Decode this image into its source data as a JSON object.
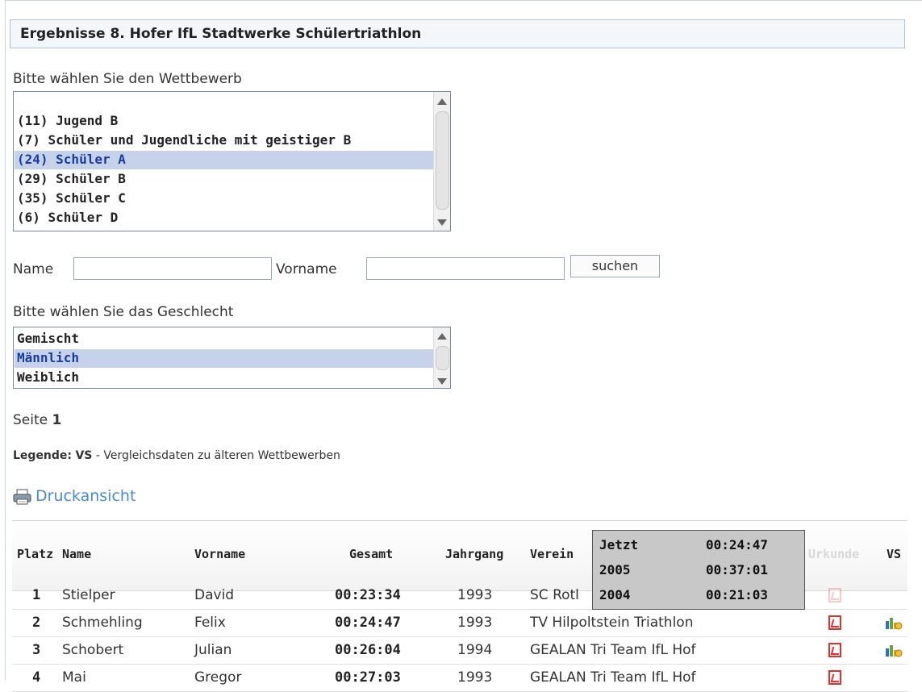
{
  "page": {
    "title": "Ergebnisse 8. Hofer IfL Stadtwerke Schülertriathlon"
  },
  "competition": {
    "label": "Bitte wählen Sie den Wettbewerb",
    "options": [
      {
        "text": "(11) Jugend B",
        "selected": false
      },
      {
        "text": "(7) Schüler und Jugendliche mit geistiger B",
        "selected": false
      },
      {
        "text": "(24) Schüler A",
        "selected": true
      },
      {
        "text": "(29) Schüler B",
        "selected": false
      },
      {
        "text": "(35) Schüler C",
        "selected": false
      },
      {
        "text": "(6) Schüler D",
        "selected": false
      }
    ]
  },
  "search": {
    "name_label": "Name",
    "name_value": "",
    "vorname_label": "Vorname",
    "vorname_value": "",
    "button_label": "suchen"
  },
  "gender": {
    "label": "Bitte wählen Sie das Geschlecht",
    "options": [
      {
        "text": "Gemischt",
        "selected": false
      },
      {
        "text": "Männlich",
        "selected": true
      },
      {
        "text": "Weiblich",
        "selected": false
      }
    ]
  },
  "paging": {
    "label": "Seite",
    "page": "1"
  },
  "legend": {
    "title": "Legende:",
    "key": "VS",
    "text": "- Vergleichsdaten zu älteren Wettbewerben"
  },
  "print": {
    "icon": "printer-icon",
    "label": "Druckansicht"
  },
  "table": {
    "headers": {
      "platz": "Platz",
      "name": "Name",
      "vorname": "Vorname",
      "gesamt": "Gesamt",
      "jahrgang": "Jahrgang",
      "verein": "Verein",
      "urkunde": "Urkunde",
      "vs": "VS"
    },
    "rows": [
      {
        "platz": "1",
        "name": "Stielper",
        "vorname": "David",
        "gesamt": "00:23:34",
        "jahrgang": "1993",
        "verein": "SC Rotl",
        "urkunde": true,
        "vs": false
      },
      {
        "platz": "2",
        "name": "Schmehling",
        "vorname": "Felix",
        "gesamt": "00:24:47",
        "jahrgang": "1993",
        "verein": "TV Hilpoltstein Triathlon",
        "urkunde": true,
        "vs": true
      },
      {
        "platz": "3",
        "name": "Schobert",
        "vorname": "Julian",
        "gesamt": "00:26:04",
        "jahrgang": "1994",
        "verein": "GEALAN Tri Team IfL Hof",
        "urkunde": true,
        "vs": true
      },
      {
        "platz": "4",
        "name": "Mai",
        "vorname": "Gregor",
        "gesamt": "00:27:03",
        "jahrgang": "1993",
        "verein": "GEALAN Tri Team IfL Hof",
        "urkunde": true,
        "vs": false
      }
    ]
  },
  "tooltip": {
    "rows": [
      {
        "label": "Jetzt",
        "time": "00:24:47"
      },
      {
        "label": "2005",
        "time": "00:37:01"
      },
      {
        "label": "2004",
        "time": "00:21:03"
      }
    ]
  },
  "colors": {
    "selection": "#c6d2ea",
    "link": "#4a8ac8",
    "pdf": "#e03030"
  }
}
